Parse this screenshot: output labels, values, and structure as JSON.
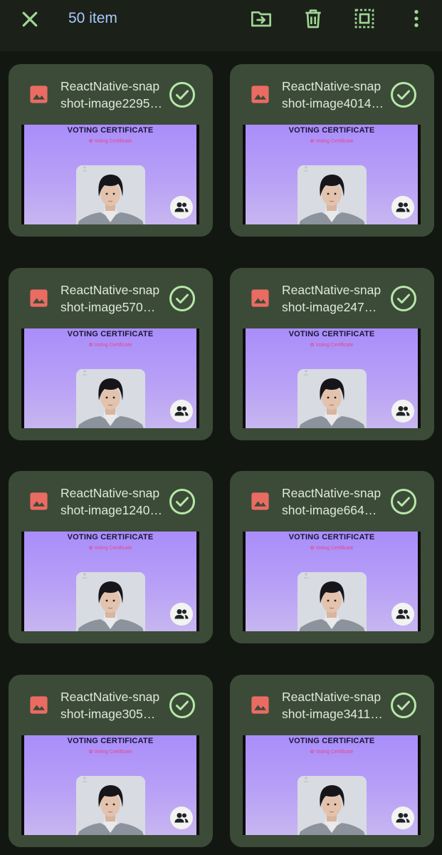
{
  "header": {
    "item_count": "50 item",
    "accent_color": "#a8c8ff",
    "icons": [
      "close-icon",
      "move-to-folder-icon",
      "delete-icon",
      "select-all-icon",
      "more-vert-icon"
    ]
  },
  "thumbnail": {
    "title": "VOTING CERTIFICATE",
    "subtitle": "✿ Voting Certificate",
    "badge_icon": "people-icon"
  },
  "files": [
    {
      "name_line1": "ReactNative-snap",
      "name_line2": "shot-image2295…",
      "selected": true
    },
    {
      "name_line1": "ReactNative-snap",
      "name_line2": "shot-image4014…",
      "selected": true
    },
    {
      "name_line1": "ReactNative-snap",
      "name_line2": "shot-image570…",
      "selected": true
    },
    {
      "name_line1": "ReactNative-snap",
      "name_line2": "shot-image247…",
      "selected": true
    },
    {
      "name_line1": "ReactNative-snap",
      "name_line2": "shot-image1240…",
      "selected": true
    },
    {
      "name_line1": "ReactNative-snap",
      "name_line2": "shot-image664…",
      "selected": true
    },
    {
      "name_line1": "ReactNative-snap",
      "name_line2": "shot-image305…",
      "selected": true
    },
    {
      "name_line1": "ReactNative-snap",
      "name_line2": "shot-image3411…",
      "selected": true
    }
  ],
  "colors": {
    "background": "#131712",
    "card": "#3b4b38",
    "check": "#b6e7a8",
    "file_icon": "#ea6b62"
  }
}
